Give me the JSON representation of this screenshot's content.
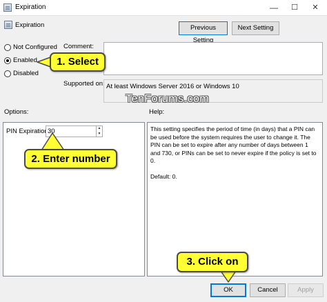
{
  "window": {
    "title": "Expiration",
    "controls": {
      "minimize": "—",
      "maximize": "☐",
      "close": "✕"
    }
  },
  "policy": {
    "name": "Expiration"
  },
  "nav": {
    "previous": "Previous Setting",
    "next": "Next Setting"
  },
  "state": {
    "options": [
      {
        "label": "Not Configured",
        "selected": false
      },
      {
        "label": "Enabled",
        "selected": true
      },
      {
        "label": "Disabled",
        "selected": false
      }
    ]
  },
  "comment": {
    "label": "Comment:",
    "value": ""
  },
  "supported": {
    "label": "Supported on:",
    "value": "At least Windows Server 2016 or Windows 10"
  },
  "watermark": "TenForums.com",
  "options_section": {
    "label": "Options:",
    "pin_label": "PIN Expiration",
    "pin_value": "30"
  },
  "help": {
    "label": "Help:",
    "text": "This setting specifies the period of time (in days) that a PIN can be used before the system requires the user to change it. The PIN can be set to expire after any number of days between 1 and 730, or PINs can be set to never expire if the policy is set to 0.",
    "default": "Default: 0."
  },
  "callouts": {
    "select": "1. Select",
    "enter_number": "2. Enter number",
    "click_on": "3. Click on"
  },
  "buttons": {
    "ok": "OK",
    "cancel": "Cancel",
    "apply": "Apply"
  },
  "colors": {
    "callout": "#ffff33",
    "arrow": "#ffff33",
    "accent": "#0078d7"
  }
}
